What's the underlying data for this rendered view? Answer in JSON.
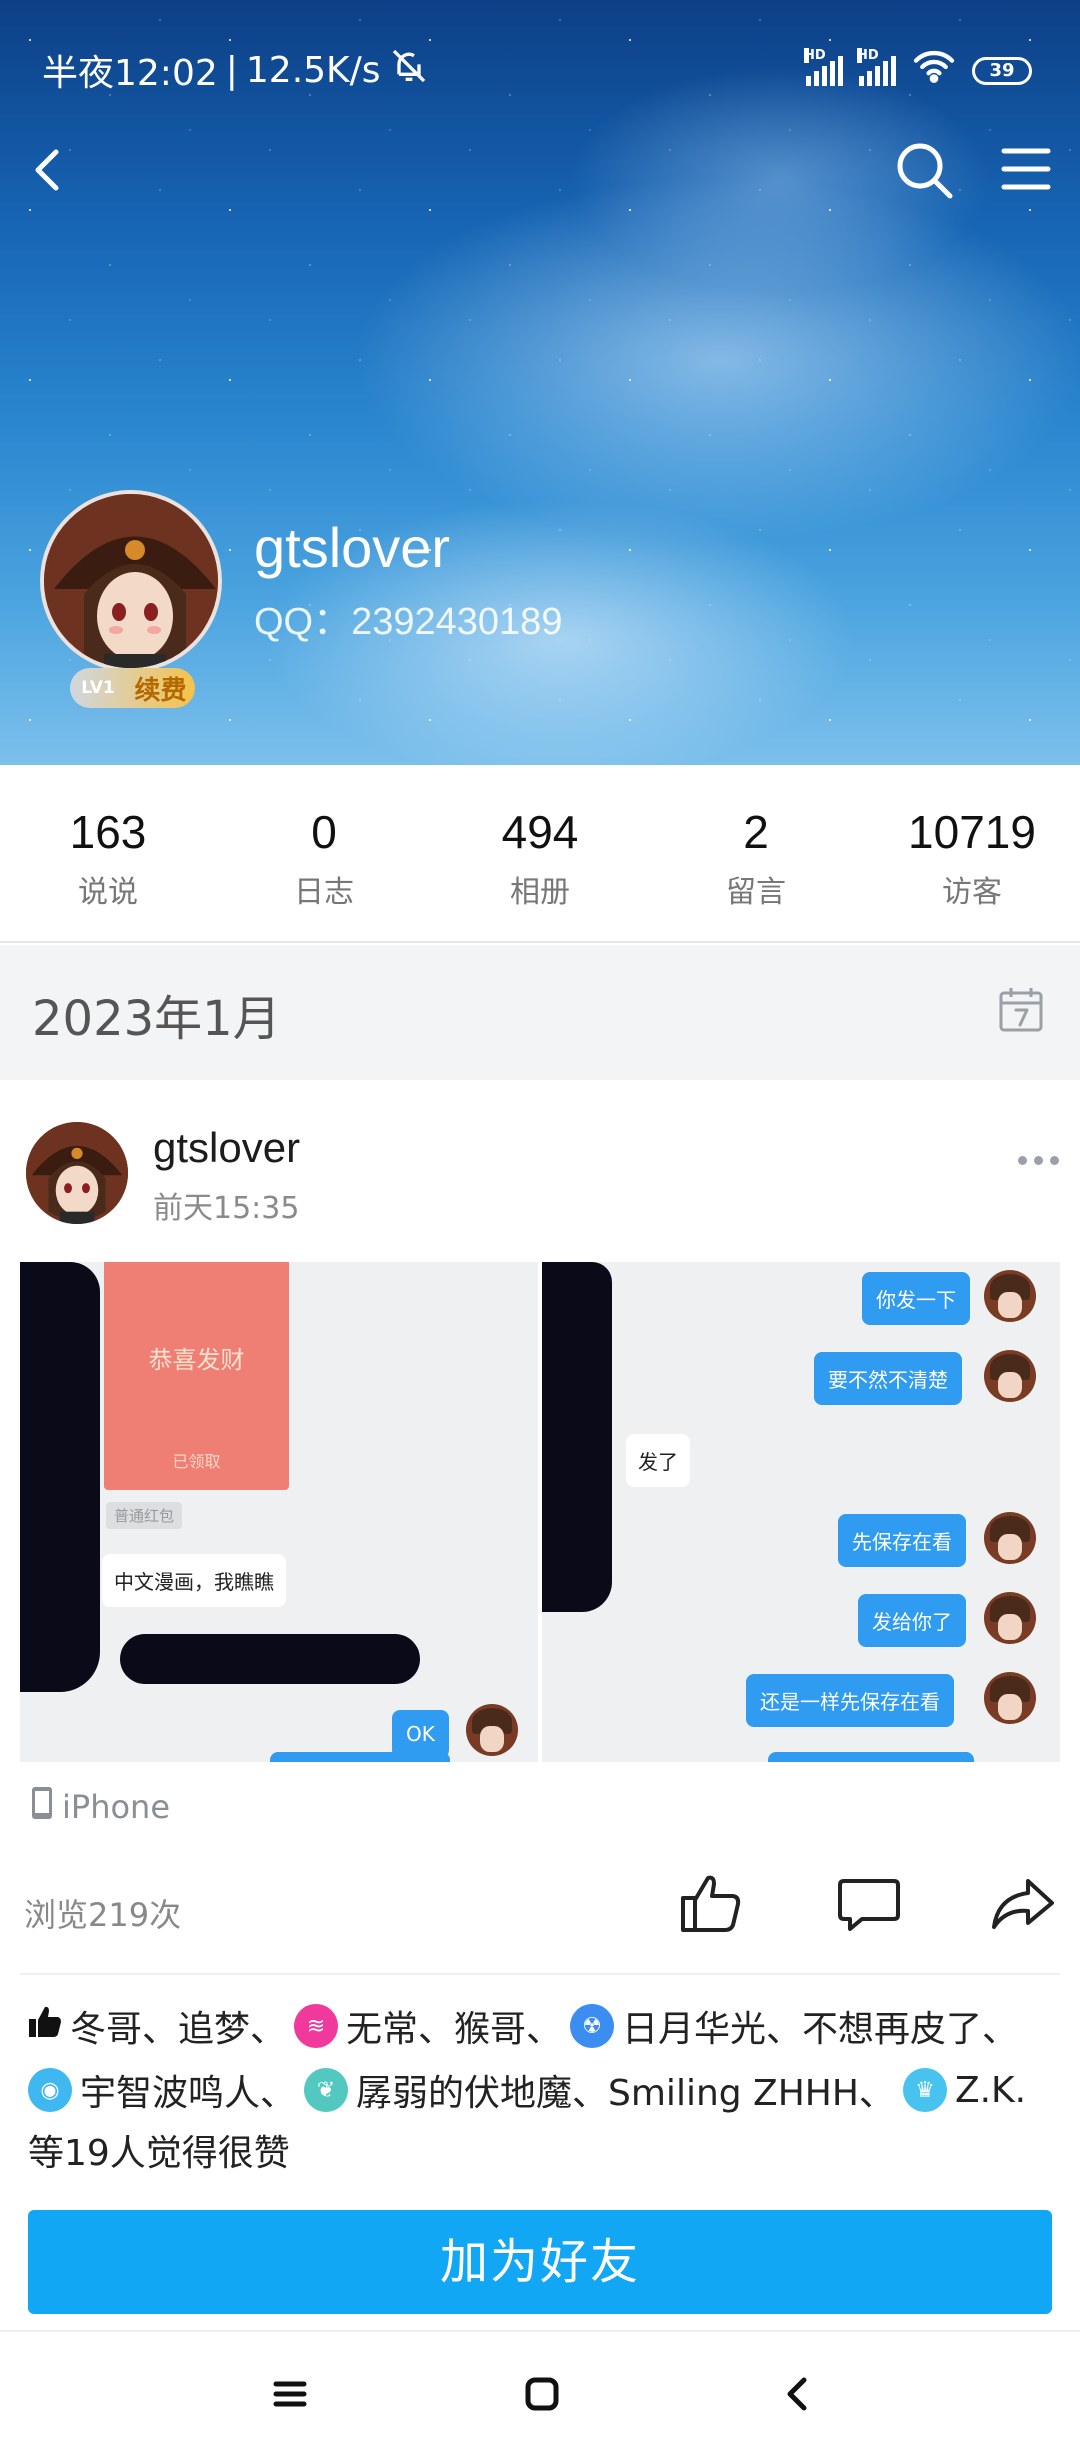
{
  "status_bar": {
    "time": "半夜12:02",
    "separator": "|",
    "speed": "12.5K/s",
    "network_label": "HD",
    "battery": "39"
  },
  "profile": {
    "name": "gtslover",
    "qq": "QQ：2392430189",
    "level": "LV1",
    "renew_label": "续费"
  },
  "stats": [
    {
      "value": "163",
      "label": "说说"
    },
    {
      "value": "0",
      "label": "日志"
    },
    {
      "value": "494",
      "label": "相册"
    },
    {
      "value": "2",
      "label": "留言"
    },
    {
      "value": "10719",
      "label": "访客"
    }
  ],
  "month": "2023年1月",
  "post": {
    "author": "gtslover",
    "time": "前天15:35",
    "left_image": {
      "red_packet_title": "恭喜发财",
      "red_packet_status": "已领取",
      "red_packet_type": "普通红包",
      "message_1": "中文漫画，我瞧瞧",
      "reply_ok": "OK"
    },
    "right_image": {
      "msg_1": "你发一下",
      "msg_2": "要不然不清楚",
      "reply": "发了",
      "msg_3": "先保存在看",
      "msg_4": "发给你了",
      "msg_5": "还是一样先保存在看"
    },
    "device": "iPhone",
    "views": "浏览219次",
    "likes": {
      "line1_a": "冬哥、追梦、",
      "line1_b": "无常、猴哥、",
      "line1_c": "日月华光、不想再皮了、",
      "line2_a": "宇智波鸣人、",
      "line2_b": "孱弱的伏地魔、Smiling ZHHH、",
      "line2_c": "Z.K.",
      "line3": "等19人觉得很赞"
    }
  },
  "add_friend": "加为好友",
  "colors": {
    "accent": "#12a7f5",
    "bubble_blue": "#2f9bf1",
    "red_packet": "#ef7f74"
  }
}
